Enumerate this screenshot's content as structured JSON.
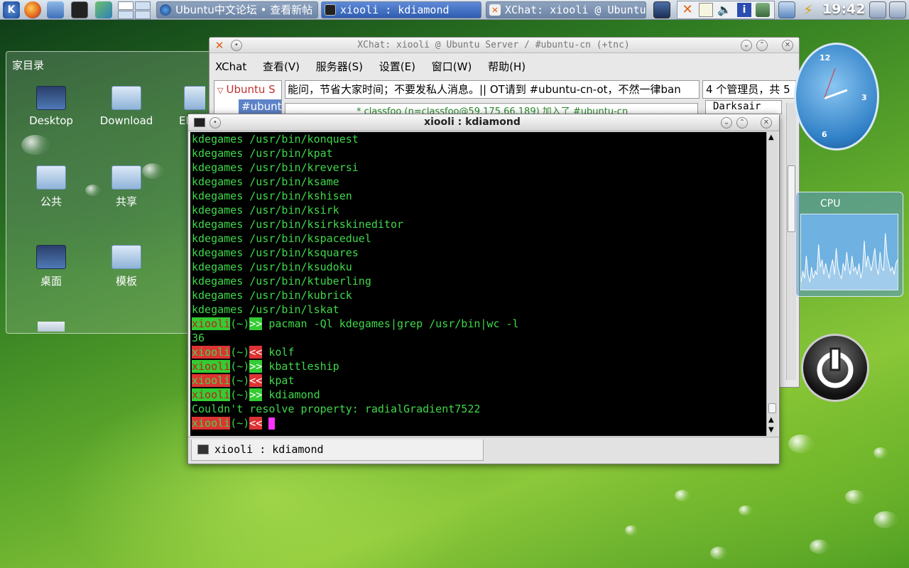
{
  "taskbar": {
    "tasks": [
      {
        "label": "Ubuntu中文论坛 • 查看新帖",
        "icon": "browser-icon"
      },
      {
        "label": "xiooli : kdiamond",
        "icon": "terminal-icon"
      },
      {
        "label": "XChat: xiooli @ Ubuntu",
        "icon": "xchat-icon"
      }
    ],
    "clock": "19:42"
  },
  "file_view": {
    "title": "家目录",
    "items": [
      "Desktop",
      "Download",
      "EI",
      "公共",
      "共享",
      "桌面",
      "模板"
    ]
  },
  "xchat": {
    "title": "XChat: xiooli @ Ubuntu Server / #ubuntu-cn (+tnc)",
    "menu": [
      "XChat",
      "查看(V)",
      "服务器(S)",
      "设置(E)",
      "窗口(W)",
      "帮助(H)"
    ],
    "tree": [
      "Ubuntu S",
      "#ubunt"
    ],
    "topic": "能问，节省大家时间；不要发私人消息。|| OT请到 #ubuntu-cn-ot，不然一律ban",
    "ops_info": "4 个管理员，共 5",
    "message_line": "* classfoo (n=classfoo@59.175.66.189) 加入了 #ubuntu-cn",
    "nick": "Darksair"
  },
  "terminal": {
    "title": "xiooli : kdiamond",
    "tab_label": "xiooli : kdiamond",
    "lines": [
      "kdegames /usr/bin/konquest",
      "kdegames /usr/bin/kpat",
      "kdegames /usr/bin/kreversi",
      "kdegames /usr/bin/ksame",
      "kdegames /usr/bin/kshisen",
      "kdegames /usr/bin/ksirk",
      "kdegames /usr/bin/ksirkskineditor",
      "kdegames /usr/bin/kspaceduel",
      "kdegames /usr/bin/ksquares",
      "kdegames /usr/bin/ksudoku",
      "kdegames /usr/bin/ktuberling",
      "kdegames /usr/bin/kubrick",
      "kdegames /usr/bin/lskat"
    ],
    "prompt_user": "xiooli",
    "prompt_dir": "(~)",
    "prompt_ok": ">>",
    "prompt_err": "<<",
    "cmd1": " pacman -Ql kdegames|grep /usr/bin|wc -l",
    "out1": "36",
    "cmd2": " kolf",
    "cmd3": " kbattleship",
    "cmd4": " kpat",
    "cmd5": " kdiamond",
    "out2": "Couldn't resolve property: radialGradient7522"
  },
  "clock_widget": {
    "n12": "12",
    "n3": "3",
    "n6": "6"
  },
  "cpu_widget": {
    "title": "CPU",
    "samples": [
      0.1,
      0.25,
      0.15,
      0.45,
      0.2,
      0.1,
      0.3,
      0.15,
      0.25,
      0.2,
      0.6,
      0.3,
      0.4,
      0.2,
      0.35,
      0.25,
      0.15,
      0.3,
      0.4,
      0.2,
      0.55,
      0.3,
      0.2,
      0.15,
      0.35,
      0.25,
      0.5,
      0.3,
      0.2,
      0.45,
      0.25,
      0.3,
      0.2,
      0.35,
      0.15,
      0.25,
      0.65,
      0.3,
      0.45,
      0.35,
      0.25,
      0.4,
      0.55,
      0.3,
      0.2,
      0.5,
      0.3,
      0.25,
      0.75,
      0.45,
      0.35,
      0.25,
      0.3,
      0.2,
      0.35,
      0.4
    ]
  },
  "colors": {
    "prompt_green": "#33cc33",
    "prompt_red": "#dd3333",
    "term_text": "#3fd84a",
    "cursor": "#ff33ff"
  }
}
